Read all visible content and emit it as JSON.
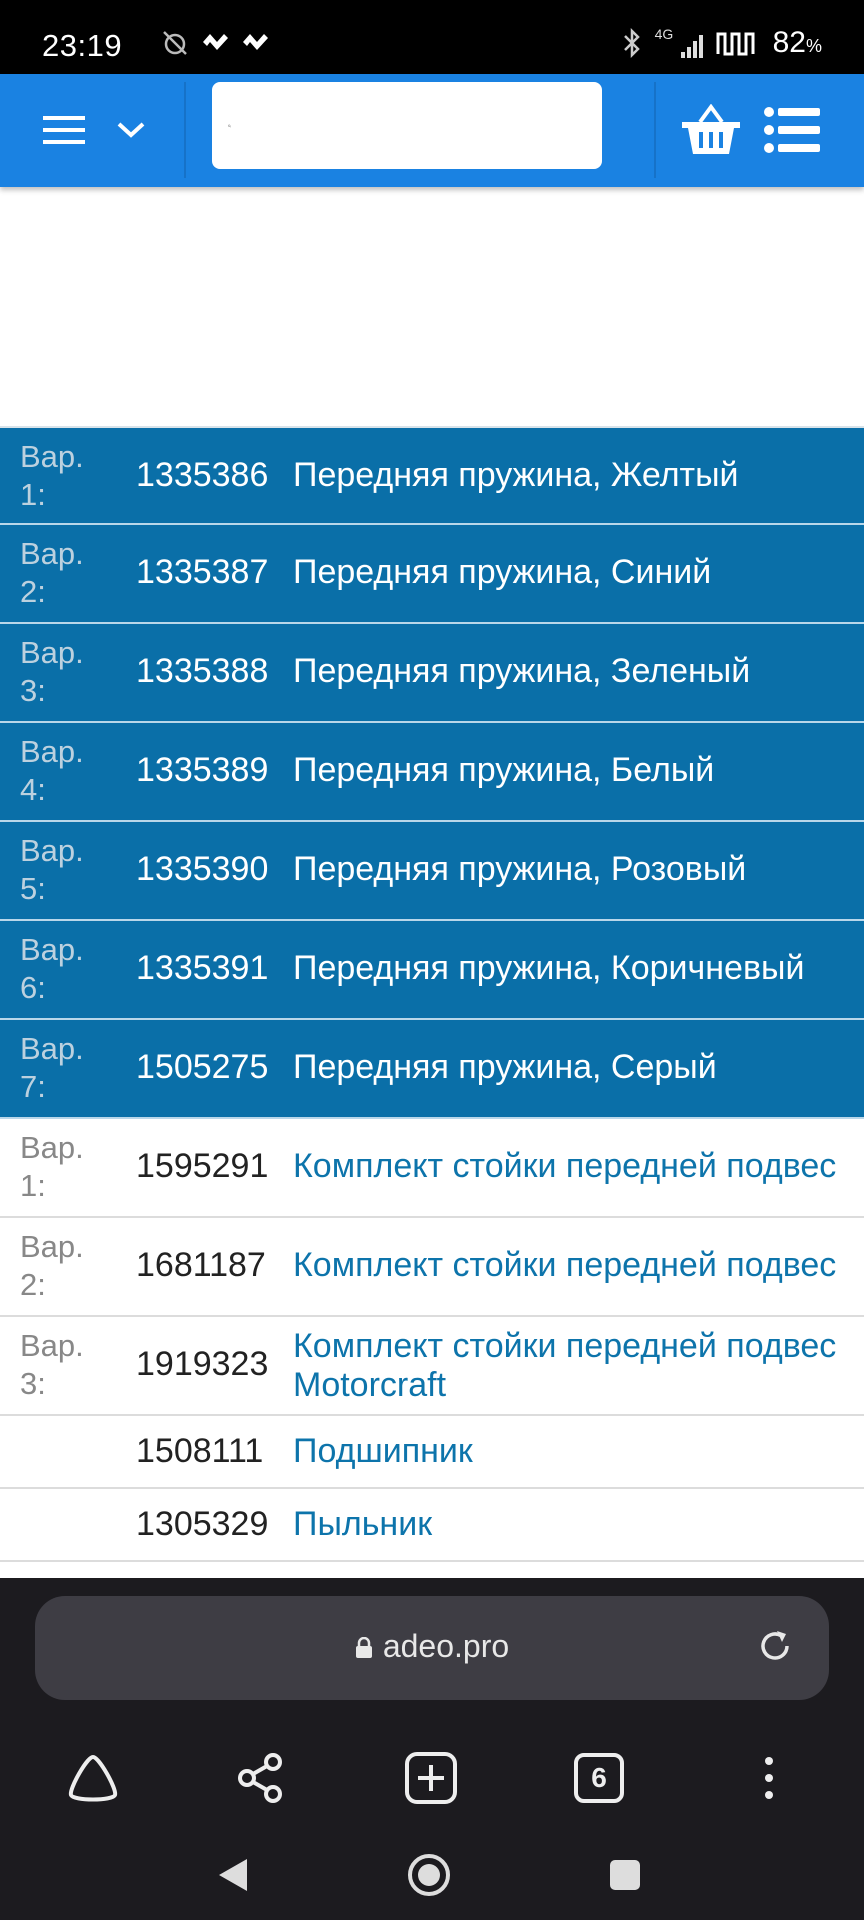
{
  "status_bar": {
    "time": "23:19",
    "network": "4G",
    "battery": "82",
    "battery_unit": "%"
  },
  "app_header": {
    "search_placeholder": "",
    "icons": [
      "menu-icon",
      "chevron-down-icon",
      "search-icon",
      "basket-icon",
      "list-icon"
    ]
  },
  "rows": [
    {
      "var": "Вар. 1:",
      "code": "1335386",
      "name": "Передняя пружина, Желтый",
      "highlighted": true
    },
    {
      "var": "Вар. 2:",
      "code": "1335387",
      "name": "Передняя пружина, Синий",
      "highlighted": true
    },
    {
      "var": "Вар. 3:",
      "code": "1335388",
      "name": "Передняя пружина, Зеленый",
      "highlighted": true
    },
    {
      "var": "Вар. 4:",
      "code": "1335389",
      "name": "Передняя пружина, Белый",
      "highlighted": true
    },
    {
      "var": "Вар. 5:",
      "code": "1335390",
      "name": "Передняя пружина, Розовый",
      "highlighted": true
    },
    {
      "var": "Вар. 6:",
      "code": "1335391",
      "name": "Передняя пружина, Коричневый",
      "highlighted": true
    },
    {
      "var": "Вар. 7:",
      "code": "1505275",
      "name": "Передняя пружина, Серый",
      "highlighted": true
    },
    {
      "var": "Вар. 1:",
      "code": "1595291",
      "name": "Комплект стойки передней подвес",
      "highlighted": false
    },
    {
      "var": "Вар. 2:",
      "code": "1681187",
      "name": "Комплект стойки передней подвес",
      "highlighted": false
    },
    {
      "var": "Вар. 3:",
      "code": "1919323",
      "name": "Комплект стойки передней подвес",
      "name2": "Motorcraft",
      "highlighted": false
    },
    {
      "var": "",
      "code": "1508111",
      "name": "Подшипник",
      "highlighted": false
    },
    {
      "var": "",
      "code": "1305329",
      "name": "Пыльник",
      "highlighted": false
    }
  ],
  "browser": {
    "url": "adeo.pro",
    "tabs_count": "6"
  }
}
